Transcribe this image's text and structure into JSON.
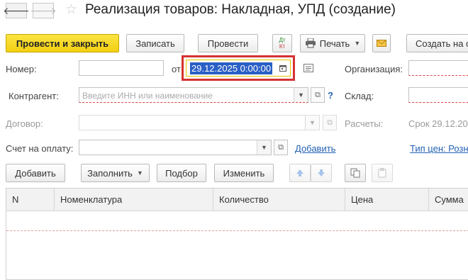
{
  "window": {
    "title": "Реализация товаров: Накладная, УПД (создание)"
  },
  "nav": {
    "back_glyph": "🡐",
    "forward_glyph": "🡒",
    "star_glyph": "☆"
  },
  "toolbar": {
    "post_close_label": "Провести и закрыть",
    "save_label": "Записать",
    "post_label": "Провести",
    "dtkt_top": "Дт",
    "dtkt_bottom": "Кт",
    "print_label": "Печать",
    "create_based_label": "Создать на о"
  },
  "form": {
    "number_label": "Номер:",
    "number_value": "",
    "from_label": "от",
    "date_value": "29.12.2025  0:00:00",
    "organization_label": "Организация:",
    "contractor_label": "Контрагент:",
    "contractor_placeholder": "Введите ИНН или наименование",
    "help_glyph": "?",
    "warehouse_label": "Склад:",
    "contract_label": "Договор:",
    "settlements_label": "Расчеты:",
    "settlements_value": "Срок 29.12.20",
    "invoice_label": "Счет на оплату:",
    "invoice_add_link": "Добавить",
    "price_type_link": "Тип цен: Розн"
  },
  "table_toolbar": {
    "add_label": "Добавить",
    "fill_label": "Заполнить",
    "selection_label": "Подбор",
    "change_label": "Изменить"
  },
  "table": {
    "columns": [
      "N",
      "Номенклатура",
      "Количество",
      "Цена",
      "Сумма"
    ],
    "rows": []
  },
  "colors": {
    "primary_button": "#f2cf12",
    "highlight_border": "#d63131",
    "selection": "#2a5fc5",
    "link": "#2160b3"
  }
}
